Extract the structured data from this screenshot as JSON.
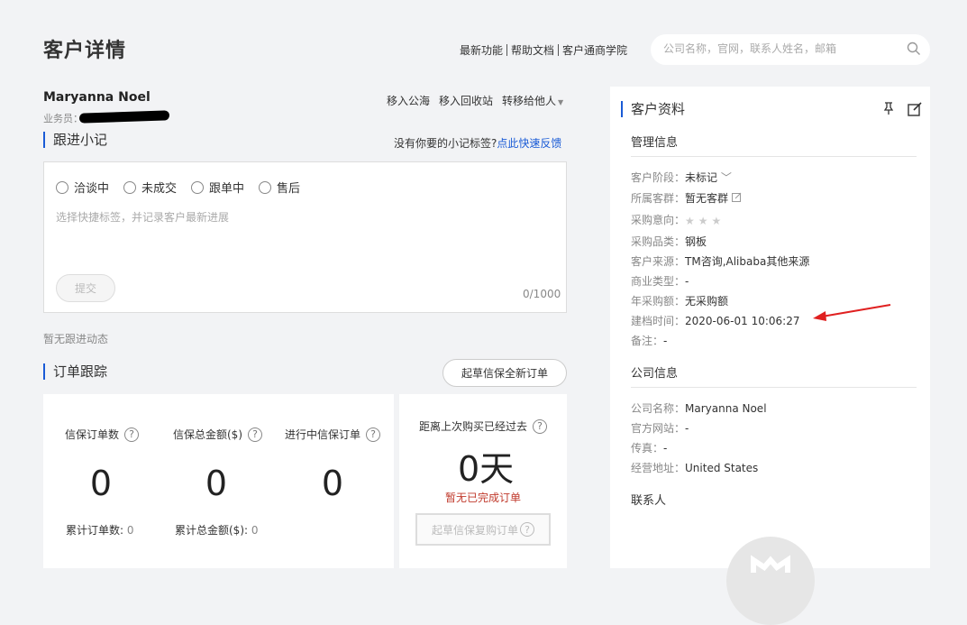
{
  "header": {
    "title": "客户详情",
    "links": [
      "最新功能",
      "帮助文档",
      "客户通商学院"
    ],
    "search_placeholder": "公司名称，官网，联系人姓名，邮箱"
  },
  "customer": {
    "name": "Maryanna Noel",
    "salesman_label": "业务员：",
    "actions": [
      "移入公海",
      "移入回收站",
      "转移给他人"
    ]
  },
  "follow": {
    "title": "跟进小记",
    "hint_text": "没有你要的小记标签?",
    "hint_link": "点此快速反馈",
    "tags": [
      "洽谈中",
      "未成交",
      "跟单中",
      "售后"
    ],
    "placeholder": "选择快捷标签，并记录客户最新进展",
    "submit_label": "提交",
    "counter": "0/1000",
    "no_activity": "暂无跟进动态"
  },
  "orders": {
    "title": "订单跟踪",
    "new_order_label": "起草信保全新订单",
    "stats": [
      {
        "label": "信保订单数",
        "value": "0"
      },
      {
        "label": "信保总金额($)",
        "value": "0"
      },
      {
        "label": "进行中信保订单",
        "value": "0"
      }
    ],
    "cum_count_label": "累计订单数:",
    "cum_count_value": "0",
    "cum_amount_label": "累计总金额($):",
    "cum_amount_value": "0",
    "last_purchase_label": "距离上次购买已经过去",
    "days_value": "0天",
    "no_completed": "暂无已完成订单",
    "repeat_order_label": "起草信保复购订单"
  },
  "profile": {
    "title": "客户资料",
    "mgmt_title": "管理信息",
    "mgmt": [
      {
        "k": "客户阶段：",
        "v": "未标记"
      },
      {
        "k": "所属客群：",
        "v": "暂无客群"
      },
      {
        "k": "采购意向：",
        "v": ""
      },
      {
        "k": "采购品类：",
        "v": "钢板"
      },
      {
        "k": "客户来源：",
        "v": "TM咨询,Alibaba其他来源"
      },
      {
        "k": "商业类型：",
        "v": "-"
      },
      {
        "k": "年采购额：",
        "v": "无采购额"
      },
      {
        "k": "建档时间：",
        "v": "2020-06-01 10:06:27"
      },
      {
        "k": "备注：",
        "v": "-"
      }
    ],
    "company_title": "公司信息",
    "company": [
      {
        "k": "公司名称：",
        "v": "Maryanna Noel"
      },
      {
        "k": "官方网站：",
        "v": "-"
      },
      {
        "k": "传真：",
        "v": "-"
      },
      {
        "k": "经营地址：",
        "v": "United States"
      }
    ],
    "contacts_title": "联系人"
  },
  "colors": {
    "accent": "#1a5bd6",
    "warn": "#c0392b",
    "annotation_arrow": "#e02020"
  }
}
